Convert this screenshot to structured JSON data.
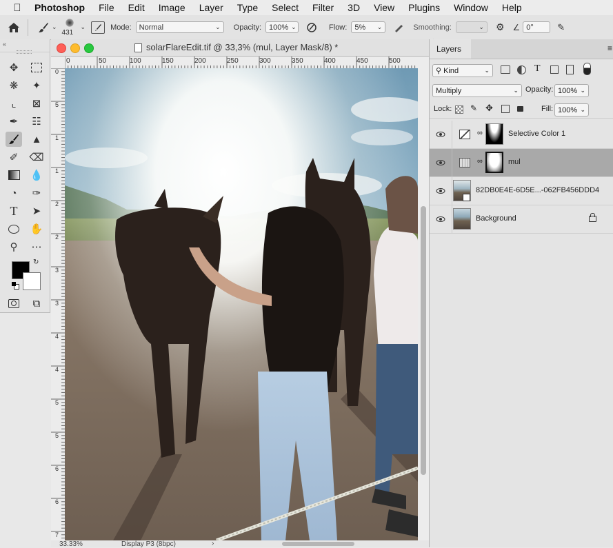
{
  "menubar": {
    "app": "Photoshop",
    "items": [
      "File",
      "Edit",
      "Image",
      "Layer",
      "Type",
      "Select",
      "Filter",
      "3D",
      "View",
      "Plugins",
      "Window",
      "Help"
    ]
  },
  "options": {
    "brush_size": "431",
    "mode_label": "Mode:",
    "mode_value": "Normal",
    "opacity_label": "Opacity:",
    "opacity_value": "100%",
    "flow_label": "Flow:",
    "flow_value": "5%",
    "smoothing_label": "Smoothing:",
    "angle_value": "0°"
  },
  "document": {
    "title": "solarFlareEdit.tif @ 33,3% (mul, Layer Mask/8) *",
    "ruler_top": [
      "0",
      "50",
      "100",
      "150",
      "200",
      "250",
      "300",
      "350",
      "400",
      "450",
      "500"
    ],
    "ruler_left": [
      "0",
      "5",
      "1",
      "1",
      "2",
      "2",
      "3",
      "3",
      "4",
      "4",
      "5",
      "5",
      "6",
      "6",
      "7"
    ],
    "zoom": "33.33%",
    "profile": "Display P3 (8bpc)"
  },
  "layers_panel": {
    "tab": "Layers",
    "filter_kind": "Kind",
    "blend_mode": "Multiply",
    "opacity_label": "Opacity:",
    "opacity_value": "100%",
    "lock_label": "Lock:",
    "fill_label": "Fill:",
    "fill_value": "100%",
    "layers": [
      {
        "name": "Selective Color 1",
        "selected": false
      },
      {
        "name": "mul",
        "selected": true
      },
      {
        "name": "82DB0E4E-6D5E...-062FB456DDD4",
        "selected": false
      },
      {
        "name": "Background",
        "selected": false
      }
    ]
  },
  "colors": {
    "foreground": "#000000",
    "background": "#ffffff",
    "selected_layer": "#a9a9a9"
  }
}
